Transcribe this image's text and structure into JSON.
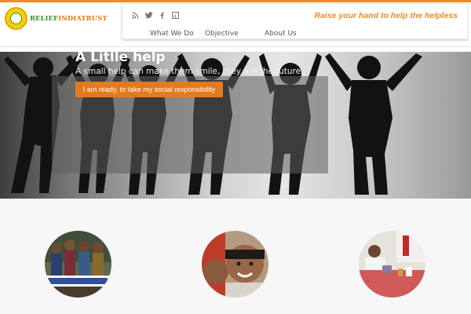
{
  "logo": {
    "text_green": "RELIEF",
    "text_orange": "INDIA",
    "text_green_2": "TRUST",
    "seal_text": [
      "RELIEF",
      "INDIA",
      "TRUST"
    ]
  },
  "header": {
    "tagline": "Raise your hand to help the helpless",
    "social_icons": [
      "rss-icon",
      "twitter-icon",
      "facebook-icon",
      "google-plus-icon"
    ],
    "menu": [
      "What We Do",
      "Objective",
      "About Us"
    ]
  },
  "hero": {
    "title": "A Litlle help",
    "subtitle": "A small help can make them smile, they are the future",
    "button_label": "I am ready, to take my social responsibility"
  },
  "colors": {
    "accent": "#f08a24",
    "button": "#e47a1e",
    "logo_green": "#3a8f2a"
  },
  "gallery": [
    "awareness-camp-photo",
    "smiling-children-photo",
    "medical-camp-photo"
  ]
}
